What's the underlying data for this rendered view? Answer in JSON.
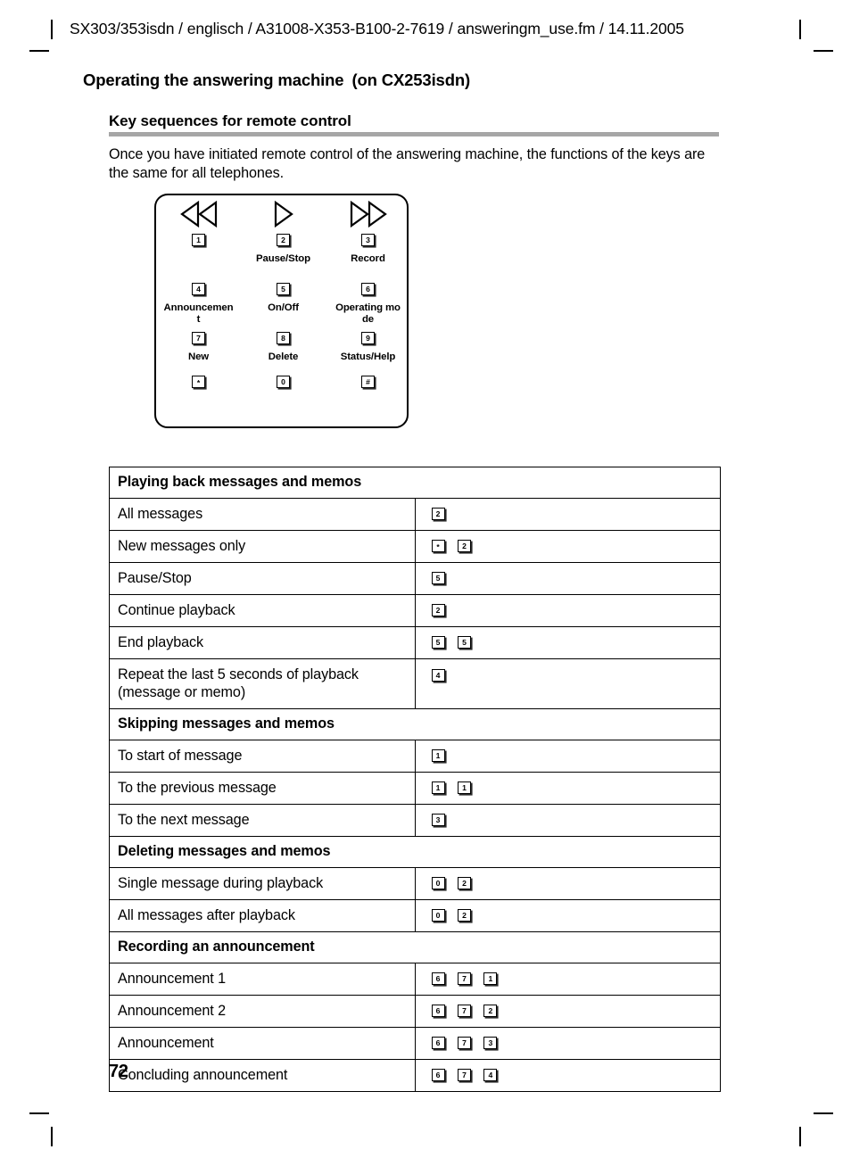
{
  "page": {
    "running_header": "SX303/353isdn / englisch / A31008-X353-B100-2-7619 / answeringm_use.fm / 14.11.2005",
    "chapter_title": "Operating the answering machine",
    "chapter_subtitle": "(on CX253isdn)",
    "section_title": "Key sequences for remote control",
    "intro": "Once you have initiated remote control of the answering machine, the functions of the keys are the same for all telephones.",
    "folio": "72",
    "rule_color": "#a6a6a6"
  },
  "keypad": {
    "icons": {
      "rewind": "rewind-double-triangle-icon",
      "play": "play-triangle-icon",
      "forward": "fast-forward-double-triangle-icon"
    },
    "rows": [
      {
        "keys": [
          "1",
          "2",
          "3"
        ],
        "labels": [
          "",
          "Pause/Stop",
          "Record"
        ]
      },
      {
        "keys": [
          "4",
          "5",
          "6"
        ],
        "labels": [
          "Announcement",
          "On/Off",
          "Operating mode"
        ]
      },
      {
        "keys": [
          "7",
          "8",
          "9"
        ],
        "labels": [
          "New",
          "Delete",
          "Status/Help"
        ]
      },
      {
        "keys": [
          "*",
          "0",
          "#"
        ],
        "labels": [
          "",
          "",
          ""
        ]
      }
    ]
  },
  "table": {
    "sections": [
      {
        "heading": "Playing back messages and memos",
        "rows": [
          {
            "desc": "All messages",
            "keys": [
              "2"
            ]
          },
          {
            "desc": "New messages only",
            "keys": [
              "*",
              "2"
            ]
          },
          {
            "desc": "Pause/Stop",
            "keys": [
              "5"
            ]
          },
          {
            "desc": "Continue playback",
            "keys": [
              "2"
            ]
          },
          {
            "desc": "End playback",
            "keys": [
              "5",
              "5"
            ]
          },
          {
            "desc": "Repeat the last 5 seconds of playback (message or memo)",
            "keys": [
              "4"
            ]
          }
        ]
      },
      {
        "heading": "Skipping messages and memos",
        "rows": [
          {
            "desc": "To start of message",
            "keys": [
              "1"
            ]
          },
          {
            "desc": "To the previous message",
            "keys": [
              "1",
              "1"
            ]
          },
          {
            "desc": "To the next message",
            "keys": [
              "3"
            ]
          }
        ]
      },
      {
        "heading": "Deleting messages and memos",
        "rows": [
          {
            "desc": "Single message during playback",
            "keys": [
              "0",
              "2"
            ]
          },
          {
            "desc": "All messages after playback",
            "keys": [
              "0",
              "2"
            ]
          }
        ]
      },
      {
        "heading": "Recording an announcement",
        "rows": [
          {
            "desc": "Announcement 1",
            "keys": [
              "6",
              "7",
              "1"
            ]
          },
          {
            "desc": "Announcement 2",
            "keys": [
              "6",
              "7",
              "2"
            ]
          },
          {
            "desc": "Announcement",
            "keys": [
              "6",
              "7",
              "3"
            ]
          },
          {
            "desc": "Concluding announcement",
            "keys": [
              "6",
              "7",
              "4"
            ]
          }
        ]
      }
    ]
  }
}
